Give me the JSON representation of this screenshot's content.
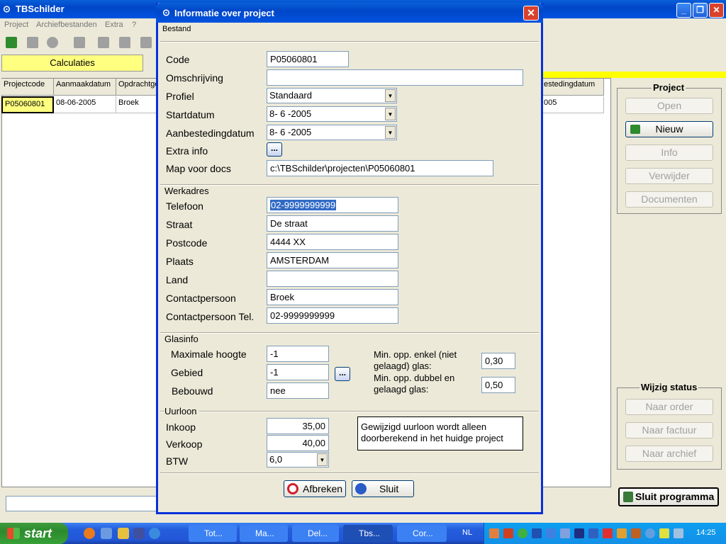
{
  "main": {
    "title": "TBSchilder",
    "menu": [
      "Project",
      "Archiefbestanden",
      "Extra",
      "?"
    ],
    "tab": "Calculaties",
    "grid": {
      "headers": [
        "Projectcode",
        "Aanmaakdatum",
        "Opdrachtge",
        "estedingdatum"
      ],
      "row": [
        "P05060801",
        "08-06-2005",
        "Broek",
        "005"
      ]
    }
  },
  "project_panel": {
    "title": "Project",
    "buttons": [
      "Open",
      "Nieuw",
      "Info",
      "Verwijder",
      "Documenten"
    ]
  },
  "status_panel": {
    "title": "Wijzig status",
    "buttons": [
      "Naar order",
      "Naar factuur",
      "Naar archief"
    ]
  },
  "exit_button": "Sluit programma",
  "dialog": {
    "title": "Informatie over project",
    "menu": "Bestand",
    "labels": {
      "code": "Code",
      "omschrijving": "Omschrijving",
      "profiel": "Profiel",
      "startdatum": "Startdatum",
      "aanbestedingdatum": "Aanbestedingdatum",
      "extra_info": "Extra info",
      "map": "Map voor docs"
    },
    "values": {
      "code": "P05060801",
      "omschrijving": "",
      "profiel": "Standaard",
      "startdatum": "8- 6 -2005",
      "aanbestedingdatum": "8- 6 -2005",
      "extra_info_btn": "...",
      "map": "c:\\TBSchilder\\projecten\\P05060801"
    },
    "werkadres": {
      "title": "Werkadres",
      "labels": [
        "Telefoon",
        "Straat",
        "Postcode",
        "Plaats",
        "Land",
        "Contactpersoon",
        "Contactpersoon Tel."
      ],
      "values": [
        "02-9999999999",
        "De straat",
        "4444 XX",
        "AMSTERDAM",
        "",
        "Broek",
        "02-9999999999"
      ]
    },
    "glasinfo": {
      "title": "Glasinfo",
      "labels": [
        "Maximale hoogte",
        "Gebied",
        "Bebouwd"
      ],
      "values": [
        "-1",
        "-1",
        "nee"
      ],
      "gebied_btn": "...",
      "enkel_label": "Min. opp. enkel (niet gelaagd) glas:",
      "enkel_value": "0,30",
      "dubbel_label": "Min. opp. dubbel en gelaagd glas:",
      "dubbel_value": "0,50"
    },
    "uurloon": {
      "title": "Uurloon",
      "labels": [
        "Inkoop",
        "Verkoop",
        "BTW"
      ],
      "inkoop": "35,00",
      "verkoop": "40,00",
      "btw": "6,0",
      "note": "Gewijzigd uurloon wordt alleen doorberekend in het huidge project"
    },
    "buttons": {
      "cancel": "Afbreken",
      "close": "Sluit"
    }
  },
  "taskbar": {
    "start": "start",
    "tasks": [
      "Tot...",
      "Ma...",
      "Del...",
      "Tbs...",
      "Cor..."
    ],
    "language": "NL",
    "clock": "14:25"
  }
}
